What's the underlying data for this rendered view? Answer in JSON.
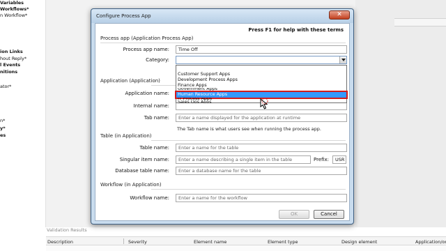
{
  "background": {
    "left_panel": [
      {
        "label": "Variables",
        "bold": true
      },
      {
        "label": "Workflows*",
        "bold": true
      },
      {
        "label": "n Workflow*",
        "bold": false
      },
      {
        "label": "ion Links",
        "bold": true
      },
      {
        "label": "hout Reply*",
        "bold": false
      },
      {
        "label": "l Events",
        "bold": true
      },
      {
        "label": "nitions",
        "bold": true
      },
      {
        "label": "ator*",
        "bold": false
      },
      {
        "label": "n*",
        "bold": false
      },
      {
        "label": "y*",
        "bold": true
      },
      {
        "label": "es",
        "bold": true
      }
    ],
    "validation": {
      "title": "Validation Results",
      "columns": [
        "Description",
        "Severity",
        "Element name",
        "Element type",
        "Design element",
        "Application/or"
      ]
    }
  },
  "dialog": {
    "title": "Configure Process App",
    "close_icon": "close-x-icon",
    "help_text": "Press F1 for help with these terms",
    "process_app": {
      "section_title": "Process app (Application Process App)",
      "name_label": "Process app name:",
      "name_value": "Time Off",
      "category_label": "Category:",
      "category_value": "",
      "category_options": [
        "Customer Support Apps",
        "Development Process Apps",
        "Finance Apps",
        "Government Apps",
        "Human Resource Apps",
        "IT Process Apps",
        "Sales Ops Apps"
      ],
      "selected_option": "Human Resource Apps"
    },
    "application": {
      "section_title": "Application (Application)",
      "app_name_label": "Application name:",
      "internal_name_label": "Internal name:",
      "tab_name_label": "Tab name:",
      "tab_name_placeholder": "Enter a name displayed for the application at runtime",
      "tab_note": "The Tab name is what users see when running the process app."
    },
    "table": {
      "section_title": "Table (in Application)",
      "table_name_label": "Table name:",
      "table_name_placeholder": "Enter a name for the table",
      "singular_label": "Singular item name:",
      "singular_placeholder": "Enter a name describing a single item in the table",
      "prefix_label": "Prefix:",
      "prefix_value": "USR",
      "db_name_label": "Database table name:",
      "db_name_placeholder": "Enter a database name for the table"
    },
    "workflow": {
      "section_title": "Workflow (in Application)",
      "workflow_name_label": "Workflow name:",
      "workflow_name_placeholder": "Enter a name for the workflow"
    },
    "buttons": {
      "ok": "OK",
      "cancel": "Cancel"
    }
  },
  "colors": {
    "selection": "#3399ff",
    "highlight_border": "#d31c1c",
    "dialog_frame": "#c9dcee"
  }
}
